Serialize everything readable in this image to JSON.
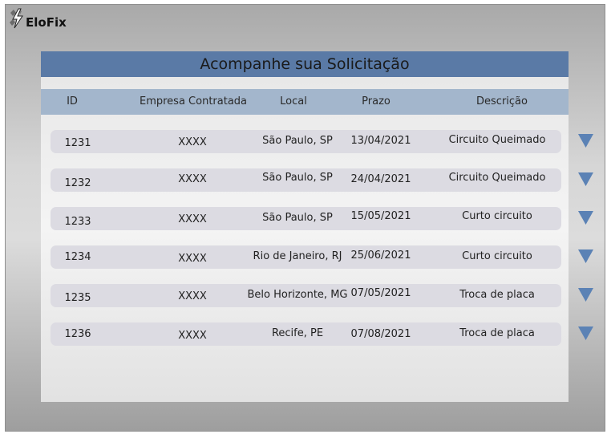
{
  "app": {
    "name": "EloFix"
  },
  "title": "Acompanhe sua Solicitação",
  "columns": {
    "id": "ID",
    "company": "Empresa Contratada",
    "location": "Local",
    "deadline": "Prazo",
    "description": "Descrição"
  },
  "rows": [
    {
      "id": "1231",
      "company": "XXXX",
      "location": "São Paulo, SP",
      "deadline": "13/04/2021",
      "description": "Circuito Queimado"
    },
    {
      "id": "1232",
      "company": "XXXX",
      "location": "São Paulo, SP",
      "deadline": "24/04/2021",
      "description": "Circuito Queimado"
    },
    {
      "id": "1233",
      "company": "XXXX",
      "location": "São Paulo, SP",
      "deadline": "15/05/2021",
      "description": "Curto circuito"
    },
    {
      "id": "1234",
      "company": "XXXX",
      "location": "Rio de Janeiro, RJ",
      "deadline": "25/06/2021",
      "description": "Curto circuito"
    },
    {
      "id": "1235",
      "company": "XXXX",
      "location": "Belo Horizonte, MG",
      "deadline": "07/05/2021",
      "description": "Troca de placa"
    },
    {
      "id": "1236",
      "company": "XXXX",
      "location": "Recife, PE",
      "deadline": "07/08/2021",
      "description": "Troca de placa"
    }
  ],
  "icons": {
    "logo": "lightning-bolt-icon",
    "row_expand": "triangle-down-icon"
  },
  "colors": {
    "title_bar": "#5a7aa6",
    "header_row": "#a3b6cc",
    "row_bg": "#dcdbe2",
    "arrow": "#5b82b5"
  }
}
